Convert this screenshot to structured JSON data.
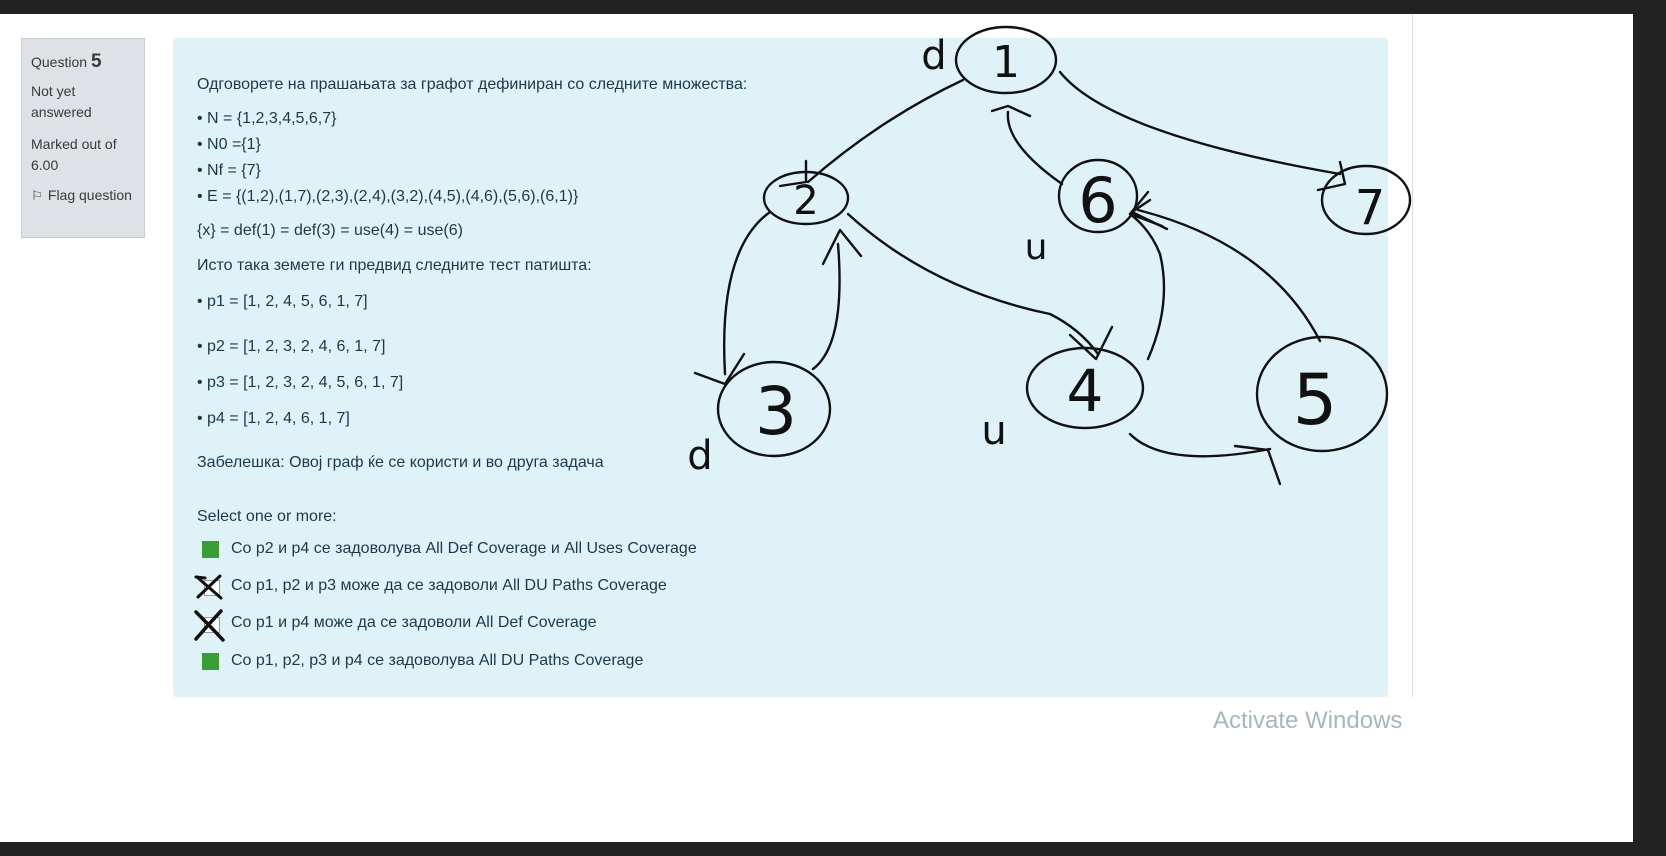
{
  "question": {
    "label": "Question",
    "number": "5",
    "state": "Not yet answered",
    "grade": "Marked out of 6.00",
    "flag_label": "Flag question"
  },
  "prompt": {
    "intro": "Одговорете на прашањата за графот дефиниран со следните множества:",
    "sets": [
      "• N = {1,2,3,4,5,6,7}",
      "• N0 ={1}",
      "• Nf = {7}",
      "• E = {(1,2),(1,7),(2,3),(2,4),(3,2),(4,5),(4,6),(5,6),(6,1)}"
    ],
    "defuse": "{x} = def(1) = def(3) = use(4) = use(6)",
    "paths_intro": "Исто така земете ги предвид следните тест патишта:",
    "paths": [
      "• p1 = [1, 2, 4, 5, 6, 1, 7]",
      "• p2 = [1, 2, 3, 2, 4, 6, 1, 7]",
      "• p3 = [1, 2, 3, 2, 4, 5, 6, 1, 7]",
      "• p4 = [1, 2, 4, 6, 1, 7]"
    ],
    "note": "Забелешка: Овој граф ќе се користи и во друга задача",
    "select_label": "Select one or more:"
  },
  "answers": [
    {
      "label": "Со  p2 и p4 се задоволува All Def Coverage и All Uses Coverage",
      "mark": "green"
    },
    {
      "label": "Со p1, p2 и p3 може да се задоволи All DU Paths Coverage",
      "mark": "cross"
    },
    {
      "label": "Со p1 и p4 може да се задоволи All Def Coverage",
      "mark": "cross"
    },
    {
      "label": "Со p1, p2, p3 и p4 се задоволува All DU Paths Coverage",
      "mark": "green"
    }
  ],
  "graph_sketch": {
    "node_labels": [
      "1",
      "2",
      "3",
      "4",
      "5",
      "6",
      "7"
    ],
    "annotations": [
      "d",
      "d",
      "u",
      "u"
    ]
  },
  "watermark": "Activate Windows",
  "colors": {
    "content_bg": "#def2f8",
    "green_mark": "#3a9c35",
    "text": "#1a3a4a"
  }
}
